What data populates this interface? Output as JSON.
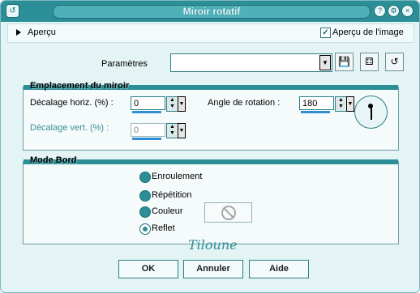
{
  "window": {
    "title": "Miroir rotatif"
  },
  "apercu": {
    "label": "Aperçu",
    "checkbox_label": "Aperçu de l'image",
    "checked": true
  },
  "params": {
    "label": "Paramètres",
    "preset_value": ""
  },
  "mirror": {
    "title": "Emplacement du miroir",
    "h_label": "Décalage horiz. (%) :",
    "h_value": "0",
    "v_label": "Décalage vert. (%) :",
    "v_value": "0",
    "rot_label": "Angle de rotation :",
    "rot_value": "180"
  },
  "edge": {
    "title": "Mode Bord",
    "options": [
      "Enroulement",
      "Répétition",
      "Couleur",
      "Reflet"
    ],
    "selected": "Reflet"
  },
  "signature": "Tiloune",
  "buttons": {
    "ok": "OK",
    "cancel": "Annuler",
    "help": "Aide"
  },
  "colors": {
    "accent": "#2c8f97",
    "panel": "#e4f3f4"
  },
  "icons": [
    "window-menu-icon",
    "help-icon",
    "settings-icon",
    "close-icon",
    "save-preset-icon",
    "randomize-icon",
    "reset-icon",
    "angle-dial",
    "no-color-icon"
  ]
}
